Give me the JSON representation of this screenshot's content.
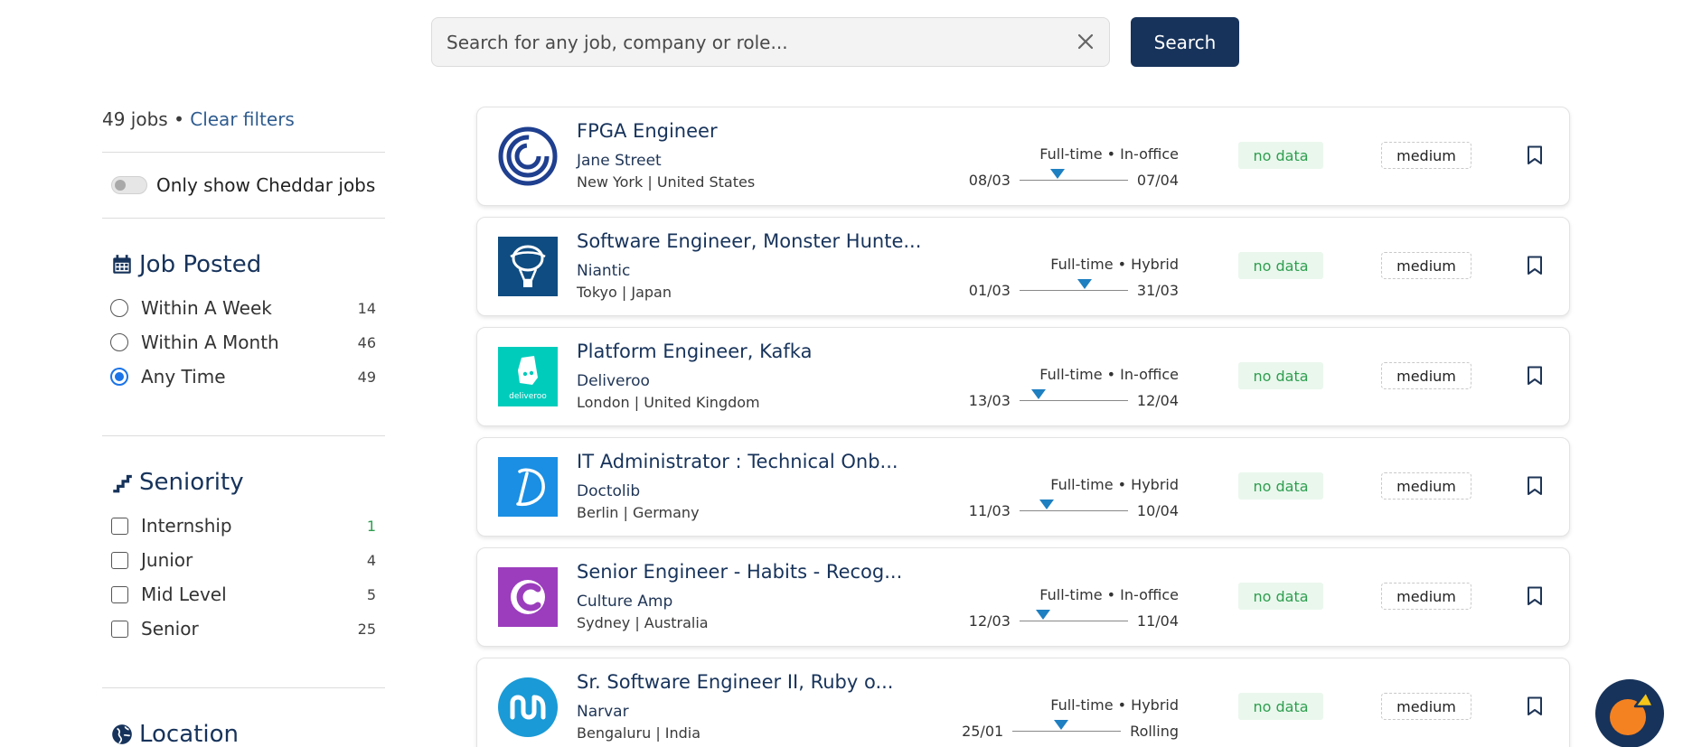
{
  "search": {
    "placeholder": "Search for any job, company or role...",
    "button_label": "Search"
  },
  "sidebar": {
    "job_count": "49 jobs",
    "separator": " • ",
    "clear_filters": "Clear filters",
    "cheddar_toggle_label": "Only show Cheddar jobs",
    "cheddar_toggle_on": false,
    "job_posted": {
      "title": "Job Posted",
      "options": [
        {
          "label": "Within A Week",
          "count": "14",
          "checked": false
        },
        {
          "label": "Within A Month",
          "count": "46",
          "checked": false
        },
        {
          "label": "Any Time",
          "count": "49",
          "checked": true
        }
      ]
    },
    "seniority": {
      "title": "Seniority",
      "options": [
        {
          "label": "Internship",
          "count": "1"
        },
        {
          "label": "Junior",
          "count": "4"
        },
        {
          "label": "Mid Level",
          "count": "5"
        },
        {
          "label": "Senior",
          "count": "25"
        }
      ]
    },
    "location": {
      "title": "Location"
    }
  },
  "jobs": [
    {
      "title": "FPGA Engineer",
      "company": "Jane Street",
      "location": "New York | United States",
      "type": "Full-time • In-office",
      "start": "08/03",
      "end": "07/04",
      "progress": 0.35,
      "salary": "no data",
      "level": "medium",
      "logo": "jane-street-logo"
    },
    {
      "title": "Software Engineer, Monster Hunte...",
      "company": "Niantic",
      "location": "Tokyo | Japan",
      "type": "Full-time • Hybrid",
      "start": "01/03",
      "end": "31/03",
      "progress": 0.6,
      "salary": "no data",
      "level": "medium",
      "logo": "niantic-logo"
    },
    {
      "title": "Platform Engineer, Kafka",
      "company": "Deliveroo",
      "location": "London | United Kingdom",
      "type": "Full-time • In-office",
      "start": "13/03",
      "end": "12/04",
      "progress": 0.18,
      "salary": "no data",
      "level": "medium",
      "logo": "deliveroo-logo",
      "logo_text": "deliveroo"
    },
    {
      "title": "IT Administrator : Technical Onb...",
      "company": "Doctolib",
      "location": "Berlin | Germany",
      "type": "Full-time • Hybrid",
      "start": "11/03",
      "end": "10/04",
      "progress": 0.25,
      "salary": "no data",
      "level": "medium",
      "logo": "doctolib-logo"
    },
    {
      "title": "Senior Engineer - Habits - Recog...",
      "company": "Culture Amp",
      "location": "Sydney | Australia",
      "type": "Full-time • In-office",
      "start": "12/03",
      "end": "11/04",
      "progress": 0.22,
      "salary": "no data",
      "level": "medium",
      "logo": "culture-amp-logo"
    },
    {
      "title": "Sr. Software Engineer II, Ruby o...",
      "company": "Narvar",
      "location": "Bengaluru | India",
      "type": "Full-time • Hybrid",
      "start": "25/01",
      "end": "Rolling",
      "progress": 0.45,
      "salary": "no data",
      "level": "medium",
      "logo": "narvar-logo"
    }
  ],
  "colors": {
    "navy": "#17335b",
    "accent_blue": "#1a73e8",
    "green": "#2e9e4f",
    "marker_blue": "#1e7fc1",
    "fab_orange": "#f58220",
    "fab_yellow": "#f5c518"
  }
}
